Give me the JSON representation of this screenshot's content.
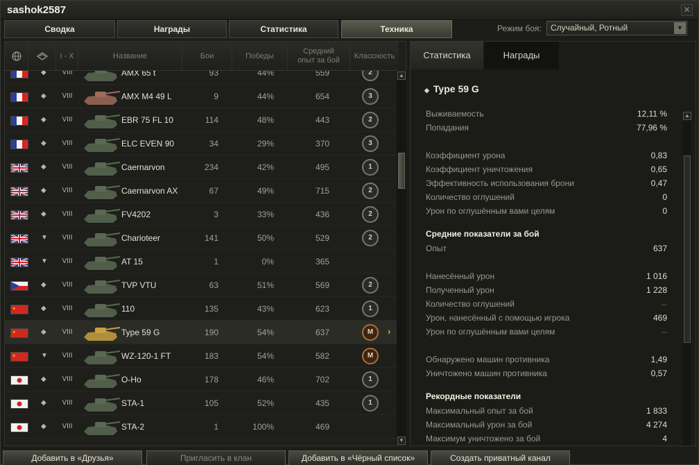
{
  "window": {
    "title": "sashok2587"
  },
  "tabs": [
    {
      "label": "Сводка"
    },
    {
      "label": "Награды"
    },
    {
      "label": "Статистика"
    },
    {
      "label": "Техника"
    }
  ],
  "battle_mode": {
    "label": "Режим боя:",
    "value": "Случайный, Ротный"
  },
  "columns": {
    "tier": "I - X",
    "name": "Название",
    "battles": "Бои",
    "wins": "Победы",
    "avg_xp": "Средний опыт за бой",
    "mastery": "Классность"
  },
  "vehicles": [
    {
      "nation": "france",
      "type_icon": "MT",
      "tier": "VIII",
      "name": "AMX 65 t",
      "battles": "93",
      "wins": "44%",
      "xp": "559",
      "mastery": "2"
    },
    {
      "nation": "france",
      "type_icon": "MT",
      "tier": "VIII",
      "name": "AMX M4 49 L",
      "battles": "9",
      "wins": "44%",
      "xp": "654",
      "mastery": "3"
    },
    {
      "nation": "france",
      "type_icon": "LT",
      "tier": "VIII",
      "name": "EBR 75 FL 10",
      "battles": "114",
      "wins": "48%",
      "xp": "443",
      "mastery": "2"
    },
    {
      "nation": "france",
      "type_icon": "LT",
      "tier": "VIII",
      "name": "ELC EVEN 90",
      "battles": "34",
      "wins": "29%",
      "xp": "370",
      "mastery": "3"
    },
    {
      "nation": "uk",
      "type_icon": "MT",
      "tier": "VIII",
      "name": "Caernarvon",
      "battles": "234",
      "wins": "42%",
      "xp": "495",
      "mastery": "1"
    },
    {
      "nation": "uk",
      "type_icon": "MT",
      "tier": "VIII",
      "name": "Caernarvon AX",
      "battles": "67",
      "wins": "49%",
      "xp": "715",
      "mastery": "2"
    },
    {
      "nation": "uk",
      "type_icon": "MT",
      "tier": "VIII",
      "name": "FV4202",
      "battles": "3",
      "wins": "33%",
      "xp": "436",
      "mastery": "2"
    },
    {
      "nation": "uk",
      "type_icon": "TD",
      "tier": "VIII",
      "name": "Charioteer",
      "battles": "141",
      "wins": "50%",
      "xp": "529",
      "mastery": "2"
    },
    {
      "nation": "uk",
      "type_icon": "TD",
      "tier": "VIII",
      "name": "AT 15",
      "battles": "1",
      "wins": "0%",
      "xp": "365",
      "mastery": ""
    },
    {
      "nation": "czech",
      "type_icon": "MT",
      "tier": "VIII",
      "name": "TVP VTU",
      "battles": "63",
      "wins": "51%",
      "xp": "569",
      "mastery": "2"
    },
    {
      "nation": "china",
      "type_icon": "MT",
      "tier": "VIII",
      "name": "110",
      "battles": "135",
      "wins": "43%",
      "xp": "623",
      "mastery": "1"
    },
    {
      "nation": "china",
      "type_icon": "MT",
      "tier": "VIII",
      "name": "Type 59 G",
      "battles": "190",
      "wins": "54%",
      "xp": "637",
      "mastery": "M",
      "selected": true
    },
    {
      "nation": "china",
      "type_icon": "TD",
      "tier": "VIII",
      "name": "WZ-120-1 FT",
      "battles": "183",
      "wins": "54%",
      "xp": "582",
      "mastery": "M"
    },
    {
      "nation": "japan",
      "type_icon": "MT",
      "tier": "VIII",
      "name": "O-Ho",
      "battles": "178",
      "wins": "46%",
      "xp": "702",
      "mastery": "1"
    },
    {
      "nation": "japan",
      "type_icon": "MT",
      "tier": "VIII",
      "name": "STA-1",
      "battles": "105",
      "wins": "52%",
      "xp": "435",
      "mastery": "1"
    },
    {
      "nation": "japan",
      "type_icon": "MT",
      "tier": "VIII",
      "name": "STA-2",
      "battles": "1",
      "wins": "100%",
      "xp": "469",
      "mastery": ""
    }
  ],
  "detail": {
    "tabs": [
      {
        "label": "Статистика"
      },
      {
        "label": "Награды"
      }
    ],
    "vehicle_name": "Type 59 G",
    "stats": [
      {
        "label": "Выживаемость",
        "value": "12,11 %"
      },
      {
        "label": "Попадания",
        "value": "77,96 %"
      },
      {
        "label": "Коэффициент урона",
        "value": "0,83"
      },
      {
        "label": "Коэффициент уничтожения",
        "value": "0,65"
      },
      {
        "label": "Эффективность использования брони",
        "value": "0,47"
      },
      {
        "label": "Количество оглушений",
        "value": "0"
      },
      {
        "label": "Урон по оглушённым вами целям",
        "value": "0"
      }
    ],
    "avg_title": "Средние показатели за бой",
    "avg": [
      {
        "label": "Опыт",
        "value": "637"
      },
      {
        "label": "Нанесённый урон",
        "value": "1 016"
      },
      {
        "label": "Полученный урон",
        "value": "1 228"
      },
      {
        "label": "Количество оглушений",
        "value": "--"
      },
      {
        "label": "Урон, нанесённый с помощью игрока",
        "value": "469"
      },
      {
        "label": "Урон по оглушённым вами целям",
        "value": "--"
      },
      {
        "label": "Обнаружено машин противника",
        "value": "1,49"
      },
      {
        "label": "Уничтожено машин противника",
        "value": "0,57"
      }
    ],
    "records_title": "Рекордные показатели",
    "records": [
      {
        "label": "Максимальный опыт за бой",
        "value": "1 833"
      },
      {
        "label": "Максимальный урон за бой",
        "value": "4 274"
      },
      {
        "label": "Максимум уничтожено за бой",
        "value": "4"
      }
    ]
  },
  "bottom_buttons": [
    {
      "label": "Добавить в «Друзья»"
    },
    {
      "label": "Пригласить в клан"
    },
    {
      "label": "Добавить в «Чёрный список»"
    },
    {
      "label": "Создать приватный канал"
    }
  ]
}
